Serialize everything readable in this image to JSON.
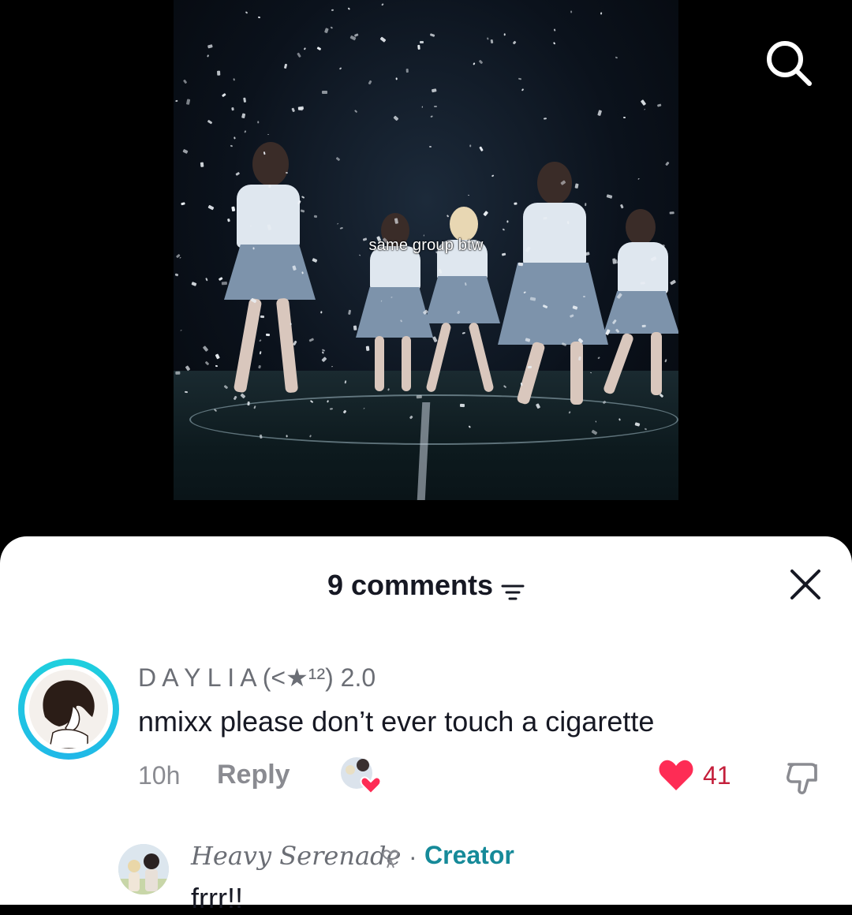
{
  "video": {
    "caption": "same group btw"
  },
  "sheet": {
    "title": "9 comments"
  },
  "comments": [
    {
      "username": "D A Y L I A (<★¹²) 2.0",
      "text": "nmixx please don’t ever touch a cigarette",
      "time": "10h",
      "reply_label": "Reply",
      "likes": "41",
      "liked": true
    }
  ],
  "reply": {
    "username": "Heavy Serenade",
    "separator": "·",
    "creator_label": "Creator",
    "text": "frrr!!"
  },
  "colors": {
    "like_red": "#fe2c55",
    "creator_teal": "#168a99",
    "ring_cyan": "#1fd1dd"
  }
}
